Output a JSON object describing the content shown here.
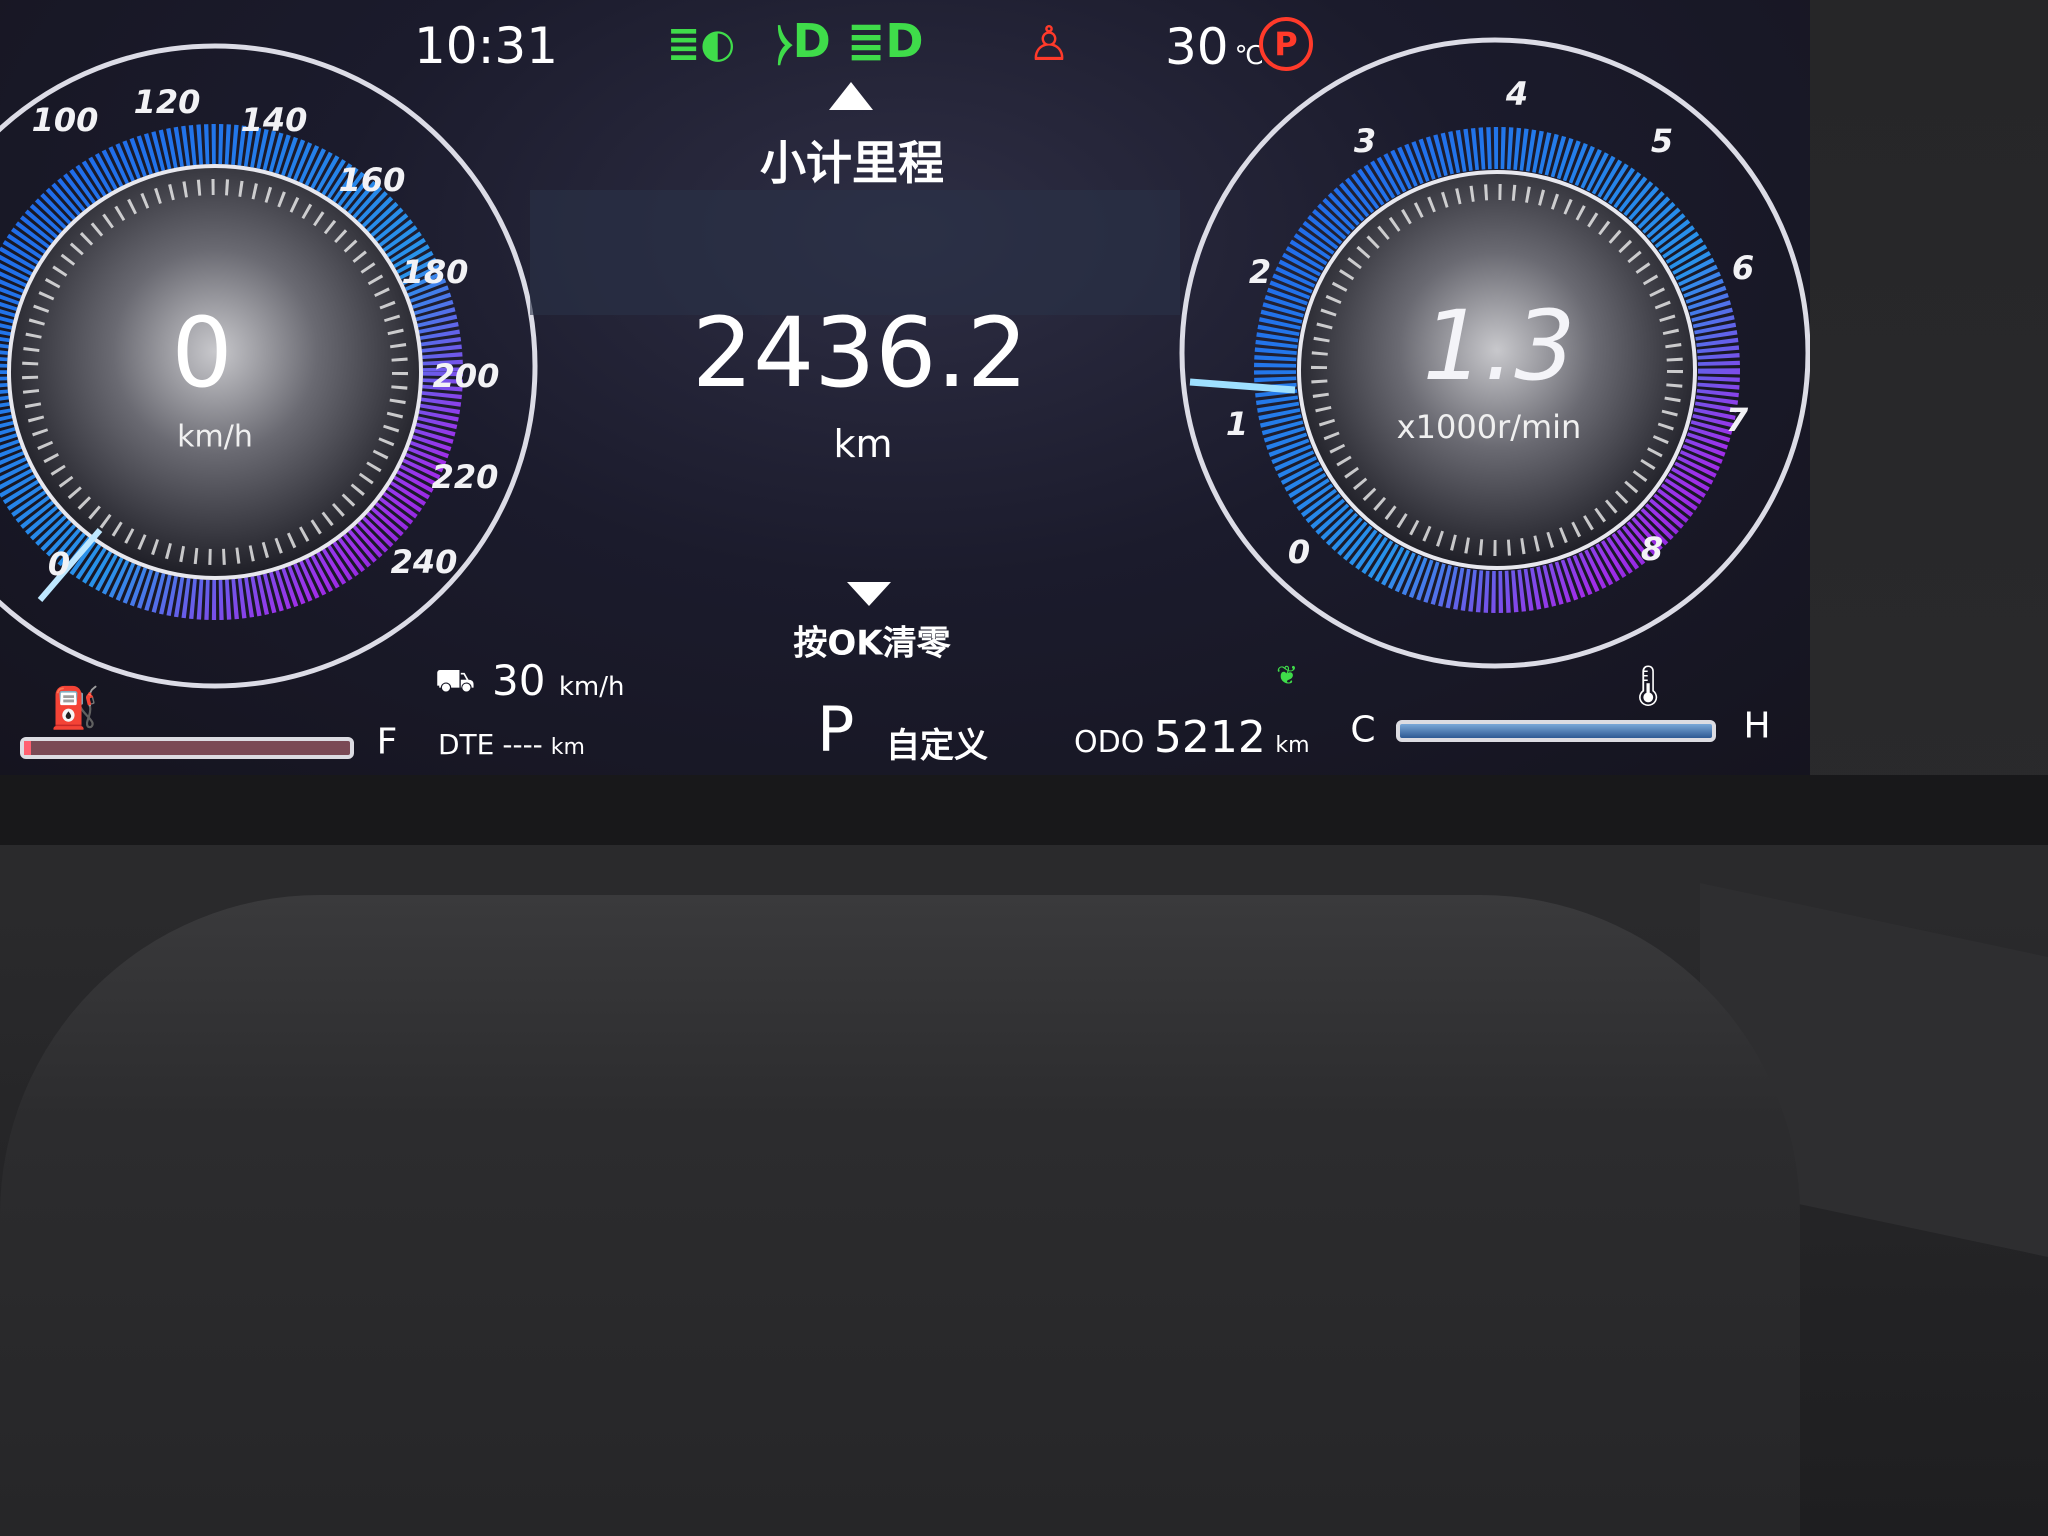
{
  "status_bar": {
    "time": "10:31",
    "outside_temp": "30",
    "temp_unit": "℃",
    "icons": [
      "low-beam-icon",
      "headlight-on-icon",
      "seatbelt-warning-icon",
      "parking-brake-icon"
    ],
    "icon_colors": {
      "green": "#3fdc4a",
      "red": "#ff3a2a",
      "amber": "#f0a030"
    }
  },
  "speedometer": {
    "value": "0",
    "unit": "km/h",
    "labels": [
      "0",
      "100",
      "120",
      "140",
      "160",
      "180",
      "200",
      "220",
      "240"
    ]
  },
  "tachometer": {
    "value": "1.3",
    "unit": "x1000r/min",
    "labels": [
      "0",
      "1",
      "2",
      "3",
      "4",
      "5",
      "6",
      "7",
      "8"
    ]
  },
  "trip": {
    "title": "小计里程",
    "value": "2436.2",
    "unit": "km",
    "reset_hint": "按OK清零"
  },
  "gear": {
    "value": "P",
    "mode": "自定义"
  },
  "speed_limit": {
    "value": "30",
    "unit": "km/h"
  },
  "fuel": {
    "full_label": "F",
    "dte_label": "DTE",
    "dte_value": "----",
    "dte_unit": "km",
    "level": 0.02
  },
  "odometer": {
    "label": "ODO",
    "value": "5212",
    "unit": "km"
  },
  "coolant": {
    "cold_label": "C",
    "hot_label": "H"
  }
}
